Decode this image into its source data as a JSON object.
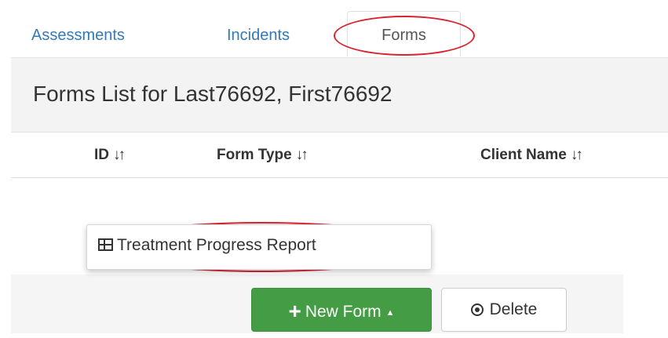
{
  "tabs": [
    {
      "label": "Assessments",
      "active": false
    },
    {
      "label": "Incidents",
      "active": false
    },
    {
      "label": "Forms",
      "active": true
    }
  ],
  "panel": {
    "title": "Forms List for Last76692, First76692"
  },
  "table": {
    "columns": [
      {
        "label": "ID",
        "sort_icon": "↓↑"
      },
      {
        "label": "Form Type",
        "sort_icon": "↓↑"
      },
      {
        "label": "Client Name",
        "sort_icon": "↓↑"
      }
    ]
  },
  "dropdown": {
    "items": [
      {
        "label": "Treatment Progress Report",
        "icon": "form-icon"
      }
    ]
  },
  "buttons": {
    "new_form": {
      "label": "New Form",
      "icon": "plus-icon",
      "color": "#449d44"
    },
    "delete": {
      "label": "Delete",
      "icon": "circle-dot-icon"
    }
  },
  "colors": {
    "link": "#337ab7",
    "highlight_oval": "#d9232d",
    "panel_bg": "#f3f3f3"
  }
}
